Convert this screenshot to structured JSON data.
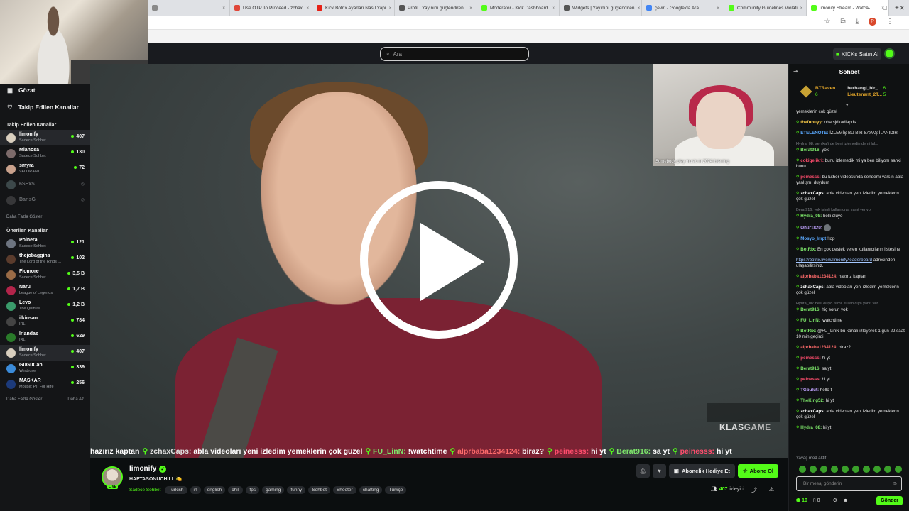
{
  "browser": {
    "tabs": [
      {
        "title": "",
        "color": "#8a8a8a"
      },
      {
        "title": "Use OTP To Proceed - zchaxi",
        "color": "#e0473a"
      },
      {
        "title": "Kick Botrix Ayarları Nasıl Yapı",
        "color": "#e62117"
      },
      {
        "title": "Profil | Yayınını güçlendiren",
        "color": "#555555"
      },
      {
        "title": "Moderator - Kick Dashboard",
        "color": "#53fc18"
      },
      {
        "title": "Widgets | Yayınını güçlendiren",
        "color": "#555555"
      },
      {
        "title": "çeviri - Google'da Ara",
        "color": "#4285f4"
      },
      {
        "title": "Community Guidelines Violati",
        "color": "#53fc18"
      },
      {
        "title": "limonify Stream - Watch",
        "color": "#53fc18",
        "active": true
      }
    ],
    "new_tab": "+",
    "window_controls": [
      "–",
      "□",
      "✕"
    ],
    "profile_initial": "P"
  },
  "top": {
    "search_placeholder": "Ara",
    "kicks_label": "KICKs Satın Al"
  },
  "sidebar": {
    "browse": "Gözat",
    "following": "Takip Edilen Kanallar",
    "followed_title": "Takip Edilen Kanallar",
    "followed": [
      {
        "name": "limonify",
        "sub": "Sadece Sohbet",
        "viewers": "407",
        "color": "#d9cfbf",
        "highlight": true
      },
      {
        "name": "Mianosa",
        "sub": "Sadece Sohbet",
        "viewers": "130",
        "color": "#7c6a6a"
      },
      {
        "name": "smyra",
        "sub": "VALORANT",
        "viewers": "72",
        "color": "#c9a18c"
      },
      {
        "name": "6SExS",
        "sub": "",
        "viewers": "",
        "color": "#8aa",
        "offline": true
      },
      {
        "name": "BarisG",
        "sub": "",
        "viewers": "",
        "color": "#777",
        "offline": true
      }
    ],
    "show_more_1": "Daha Fazla Göster",
    "recommended_title": "Önerilen Kanallar",
    "recommended": [
      {
        "name": "Poinera",
        "sub": "Sadece Sohbet",
        "viewers": "121",
        "color": "#6d7480"
      },
      {
        "name": "thejobaggins",
        "sub": "The Lord of the Rings ...",
        "viewers": "102",
        "color": "#5a3b2c"
      },
      {
        "name": "Flomore",
        "sub": "Sadece Sohbet",
        "viewers": "3,5 B",
        "color": "#9a6b46"
      },
      {
        "name": "Naru",
        "sub": "League of Legends",
        "viewers": "1,7 B",
        "color": "#b2244a"
      },
      {
        "name": "Levo",
        "sub": "The Quinfall",
        "viewers": "1,2 B",
        "color": "#3a9b6b"
      },
      {
        "name": "ilkinsan",
        "sub": "IRL",
        "viewers": "784",
        "color": "#444"
      },
      {
        "name": "Irlandas",
        "sub": "IRL",
        "viewers": "629",
        "color": "#2a7b2a"
      },
      {
        "name": "limonify",
        "sub": "Sadece Sohbet",
        "viewers": "407",
        "color": "#d9cfbf",
        "highlight": true
      },
      {
        "name": "GuGuCan",
        "sub": "Windrose",
        "viewers": "339",
        "color": "#3b8bd9"
      },
      {
        "name": "MASKAR",
        "sub": "Mouse: P.I. For Hire",
        "viewers": "256",
        "color": "#1c3a7b"
      }
    ],
    "show_more_2": "Daha Fazla Göster",
    "show_less": "Daha Az"
  },
  "player": {
    "cam_caption": "Somebody play music in 2024 listening",
    "klas_logo_a": "KLAS",
    "klas_logo_b": "GAME",
    "ticker": [
      {
        "user": "",
        "text": "hazırız kaptan",
        "color": "#ffffff"
      },
      {
        "user": "zchaxCaps:",
        "text": "abla videoları yeni izledim yemeklerin çok güzel",
        "color": "#ffffff"
      },
      {
        "user": "FU_LinN:",
        "text": "!watchtime",
        "color": "#7ee86b"
      },
      {
        "user": "alprbaba1234124:",
        "text": "biraz?",
        "color": "#ff6b6b"
      },
      {
        "user": "peinesss:",
        "text": "hi yt",
        "color": "#ff4d6d"
      },
      {
        "user": "Berat916:",
        "text": "sa yt",
        "color": "#7ee86b"
      },
      {
        "user": "peinesss:",
        "text": "hi yt",
        "color": "#ff4d6d"
      }
    ]
  },
  "stream": {
    "channel": "limonify",
    "live_badge": "LIVE",
    "title": "HAFTASONUCHILL 🍋",
    "category": "Sadece Sohbet",
    "tags": [
      "Turkish",
      "irl",
      "english",
      "chill",
      "fps",
      "gaming",
      "funny",
      "Sohbet",
      "Shooter",
      "chatting",
      "Türkçe"
    ],
    "gift_label": "Abonelik Hediye Et",
    "subscribe_label": "Abone Ol",
    "viewers": "407",
    "viewers_label": "izleyici"
  },
  "chat": {
    "title": "Sohbet",
    "leaderboard": [
      {
        "name": "BTRaven",
        "count": "6"
      },
      {
        "name": "herhangi_bir_...",
        "count": "6"
      },
      {
        "name": "Lieutenant_2T...",
        "count": "5"
      }
    ],
    "messages": [
      {
        "user": "",
        "text": "yemeklerin çok güzel",
        "color": "#ffffff"
      },
      {
        "user": "thefunuyy:",
        "text": "oha sjdkadlapds",
        "color": "#f7c948"
      },
      {
        "user": "ETELENOTE:",
        "text": "İZLEMİŞ BU BİR SAVAŞ İLANIDIR",
        "color": "#5aa9ff"
      },
      {
        "reply": "Hydra_08: sen kafirde beni izlemedin demi lal..."
      },
      {
        "user": "Berat916:",
        "text": "yok",
        "color": "#7ee86b"
      },
      {
        "user": "cokigelikri:",
        "text": "bunu izlemedik mi ya ben biliyom sanki bunu",
        "color": "#ff4d6d"
      },
      {
        "user": "peinesss:",
        "text": "bu luther videosunda sendemi varsın abla yanlışmı duydum",
        "color": "#ff4d6d"
      },
      {
        "user": "zchaxCaps:",
        "text": "abla videoları yeni izledim yemeklerin çok güzel",
        "color": "#ffffff"
      },
      {
        "reply": "Berat916: yok isimli kullanıcıya yanıt veriyor"
      },
      {
        "user": "Hydra_08:",
        "text": "belli oluyo",
        "color": "#7ee86b"
      },
      {
        "user": "Onur1820:",
        "text": "",
        "color": "#c0a3ff"
      },
      {
        "user": "Mosyo_Impt",
        "text": "!top",
        "color": "#5aa9ff"
      },
      {
        "user": "BotRix:",
        "text": "En çok destek veren kullanıcıların listesine",
        "color": "#7ee86b"
      },
      {
        "link": "https://botrix.live/k/limonify/leaderboard",
        "text": "adresinden ulaşabilirsiniz."
      },
      {
        "user": "alprbaba1234124:",
        "text": "hazırız kaptan",
        "color": "#ff6b6b"
      },
      {
        "user": "zchaxCaps:",
        "text": "abla videoları yeni izledim yemeklerin çok güzel",
        "color": "#ffffff"
      },
      {
        "reply": "Hydra_08: belli oluyo isimli kullanıcıya yanıt ver..."
      },
      {
        "user": "Berat916:",
        "text": "hiç sorun yok",
        "color": "#7ee86b"
      },
      {
        "user": "FU_LinN:",
        "text": "!watchtime",
        "color": "#7ee86b"
      },
      {
        "user": "BotRix:",
        "text": "@FU_LinN bu kanalı izleyerek 1 gün 22 saat 10 min geçirdi.",
        "color": "#7ee86b"
      },
      {
        "user": "alprbaba1234124:",
        "text": "biraz?",
        "color": "#ff6b6b"
      },
      {
        "user": "peinesss:",
        "text": "hi yt",
        "color": "#ff4d6d"
      },
      {
        "user": "Berat916:",
        "text": "sa yt",
        "color": "#7ee86b"
      },
      {
        "user": "peinesss:",
        "text": "hi yt",
        "color": "#ff4d6d"
      },
      {
        "user": "TGbulut:",
        "text": "hello t",
        "color": "#c0a3ff"
      },
      {
        "user": "TheKing52:",
        "text": "hi yt",
        "color": "#7ee86b"
      },
      {
        "user": "zchaxCaps:",
        "text": "abla videoları yeni izledim yemeklerin çok güzel",
        "color": "#ffffff"
      },
      {
        "user": "Hydra_08:",
        "text": "hi yt",
        "color": "#7ee86b"
      }
    ],
    "slow_mode": "Yavaş mod aktif",
    "input_placeholder": "Bir mesaj gönderin",
    "points": "10",
    "zero": "0",
    "send_label": "Gönder"
  }
}
